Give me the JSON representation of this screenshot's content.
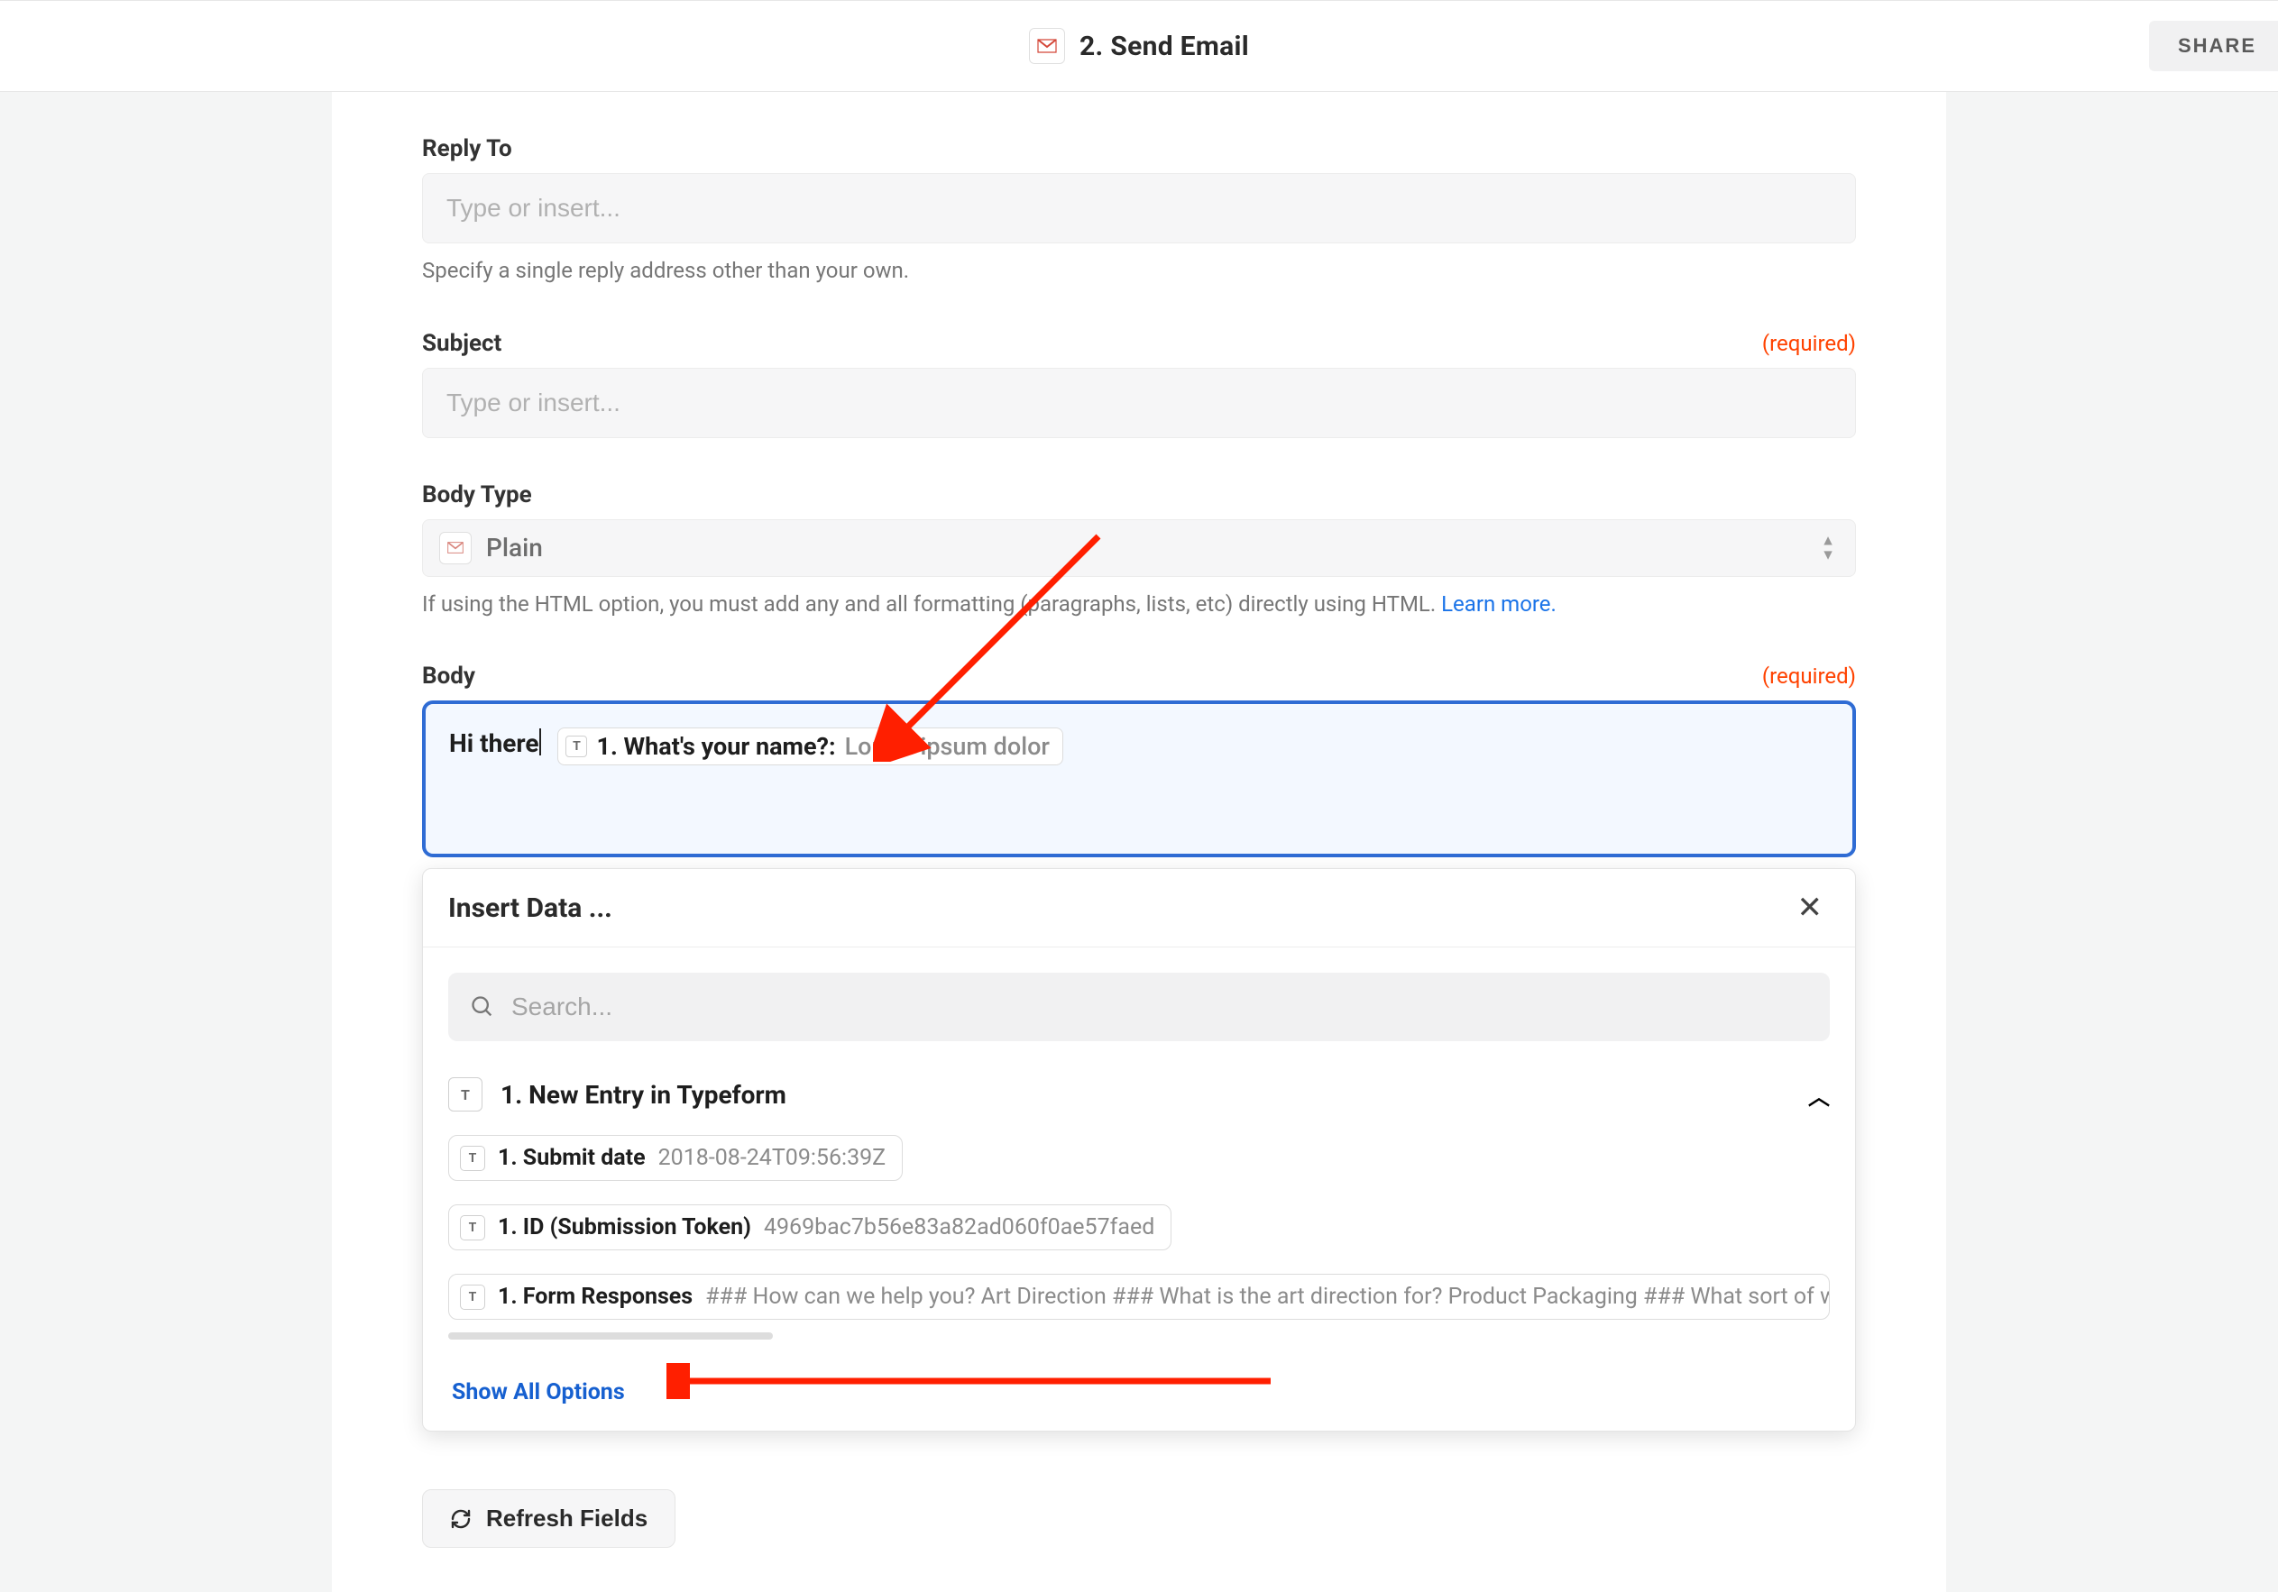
{
  "topbar": {
    "title": "2. Send Email",
    "share_label": "SHARE"
  },
  "fields": {
    "reply_to": {
      "label": "Reply To",
      "placeholder": "Type or insert...",
      "helper": "Specify a single reply address other than your own."
    },
    "subject": {
      "label": "Subject",
      "required_text": "(required)",
      "placeholder": "Type or insert..."
    },
    "body_type": {
      "label": "Body Type",
      "value": "Plain",
      "helper_prefix": "If using the HTML option, you must add any and all formatting (paragraphs, lists, etc) directly using HTML. ",
      "helper_link": "Learn more."
    },
    "body": {
      "label": "Body",
      "required_text": "(required)",
      "typed_text": "Hi there",
      "token": {
        "badge": "T",
        "label": "1. What's your name?: ",
        "sample": "Lorem ipsum dolor"
      }
    }
  },
  "popover": {
    "title": "Insert Data ...",
    "search_placeholder": "Search...",
    "group": {
      "badge": "T",
      "title": "1. New Entry in Typeform"
    },
    "chips": [
      {
        "badge": "T",
        "label": "1. Submit date",
        "sample": "2018-08-24T09:56:39Z"
      },
      {
        "badge": "T",
        "label": "1. ID (Submission Token)",
        "sample": "4969bac7b56e83a82ad060f0ae57faed"
      },
      {
        "badge": "T",
        "label": "1. Form Responses",
        "sample": "### How can we help you? Art Direction ### What is the art direction for? Product Packaging ### What sort of we"
      }
    ],
    "show_all_label": "Show All Options"
  },
  "refresh_label": "Refresh Fields",
  "colors": {
    "accent_blue": "#2f6cd4",
    "required_orange": "#ff4200",
    "link_blue": "#1a73e8",
    "annotation_red": "#ff1f00"
  }
}
